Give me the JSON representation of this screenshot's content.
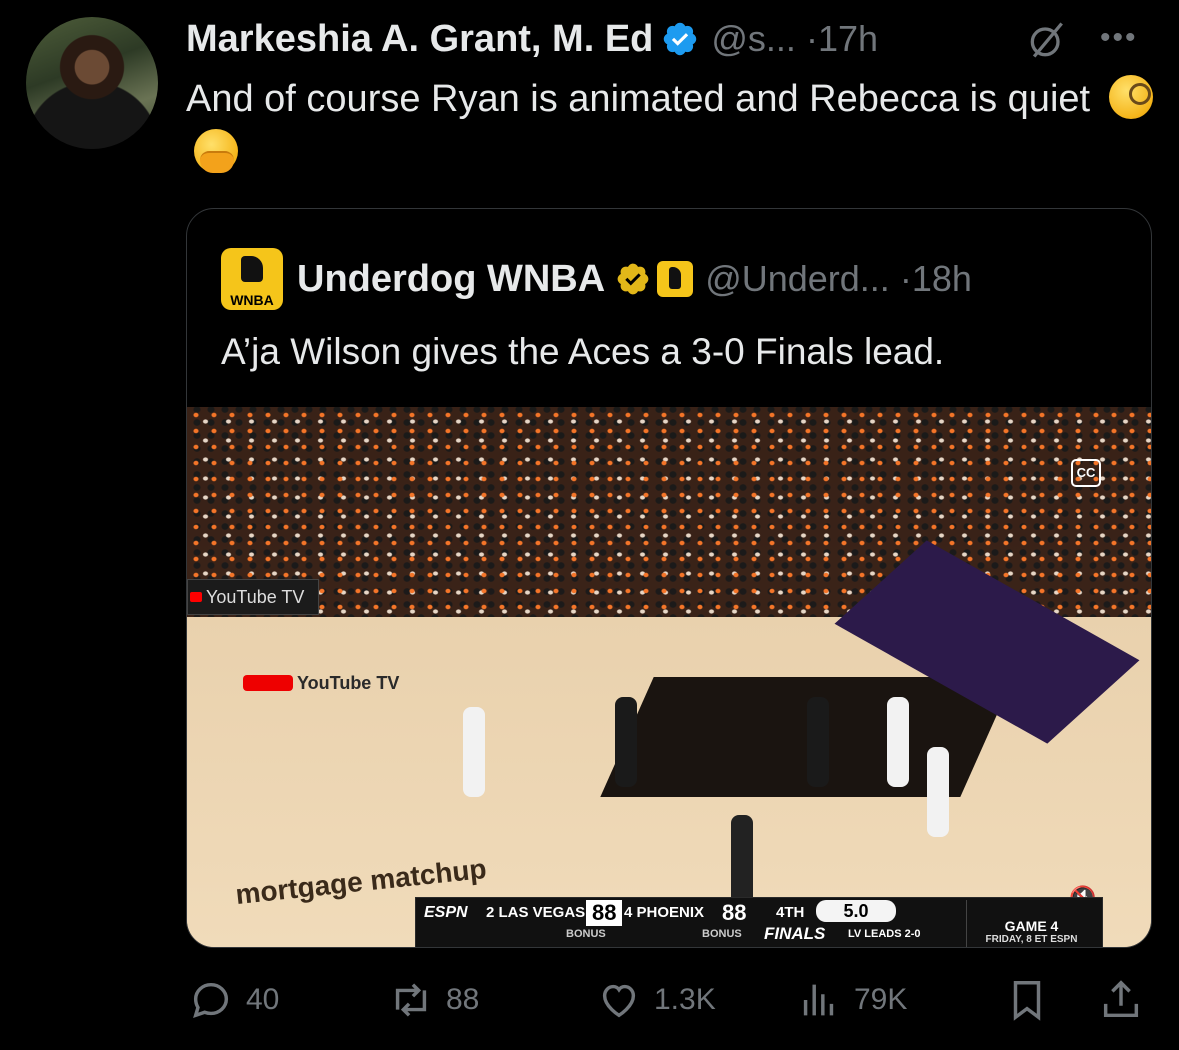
{
  "tweet": {
    "author_name": "Markeshia A. Grant, M. Ed",
    "handle": "@s...",
    "time": "·17h",
    "text": "And of course Ryan is animated and Rebecca is quiet",
    "emojis": [
      "face-with-monocle",
      "face-with-hand-over-mouth"
    ]
  },
  "quote": {
    "author_name": "Underdog WNBA",
    "handle": "@Underd...",
    "time": "·18h",
    "text": "A’ja Wilson gives the Aces a 3-0 Finals lead.",
    "avatar_label": "WNBA",
    "media": {
      "cc_label": "CC",
      "yttv_board": "YouTube TV",
      "yttv_court": "YouTube TV",
      "court_ad": "mortgage matchup",
      "scorebar": {
        "network": "ESPN",
        "team1": "2 LAS VEGAS",
        "score1": "88",
        "team2": "4 PHOENIX",
        "score2": "88",
        "quarter": "4TH",
        "clock": "5.0",
        "bonus1": "BONUS",
        "bonus2": "BONUS",
        "finals": "FINALS",
        "series": "LV LEADS 2-0",
        "game": "GAME 4",
        "game_time": "FRIDAY, 8 ET ESPN"
      }
    }
  },
  "actions": {
    "replies": "40",
    "reposts": "88",
    "likes": "1.3K",
    "views": "79K"
  },
  "colors": {
    "background": "#000000",
    "text": "#e7e9ea",
    "muted": "#71767b",
    "verified_blue": "#1d9bf0",
    "verified_gold": "#e2b719",
    "border": "#333639"
  }
}
